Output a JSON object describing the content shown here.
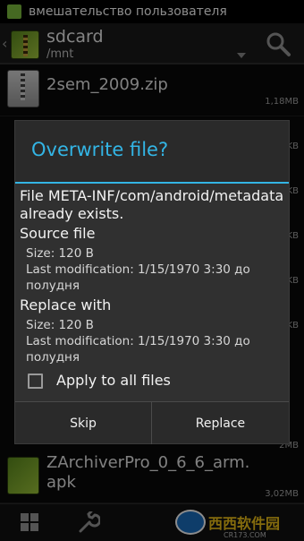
{
  "status_bar": {
    "notification": "вмешательство пользователя"
  },
  "action_bar": {
    "title": "sdcard",
    "subtitle": "/mnt",
    "search_icon": "search-icon"
  },
  "files": [
    {
      "name": "2sem_2009.zip",
      "size": "1,18MB",
      "icon": "zip-icon"
    },
    {
      "name": "ZArchiverPro_0_6_6_arm.",
      "name_line2": "apk",
      "size": "3,02MB",
      "icon": "apk-icon"
    }
  ],
  "background_fragments": [
    "KB",
    "KB",
    "KB",
    "KB",
    "KB",
    "KB",
    "KB",
    "KB",
    "KB",
    "2MB"
  ],
  "dialog": {
    "title": "Overwrite file?",
    "message": "File META-INF/com/android/metadata already exists.",
    "source_heading": "Source file",
    "source_size": "Size: 120 B",
    "source_modified": "Last modification: 1/15/1970 3:30 до",
    "source_modified_cont": "полудня",
    "replace_heading": "Replace with",
    "replace_size": "Size: 120 B",
    "replace_modified": "Last modification: 1/15/1970 3:30 до",
    "replace_modified_cont": "полудня",
    "checkbox_label": "Apply to all files",
    "checkbox_checked": false,
    "skip_label": "Skip",
    "replace_label": "Replace"
  },
  "watermark": {
    "text": "西西软件园",
    "sub": "CR173.COM"
  },
  "colors": {
    "accent": "#33b5e5",
    "dialog_bg": "#2a2a2a",
    "body_bg": "#303030"
  }
}
